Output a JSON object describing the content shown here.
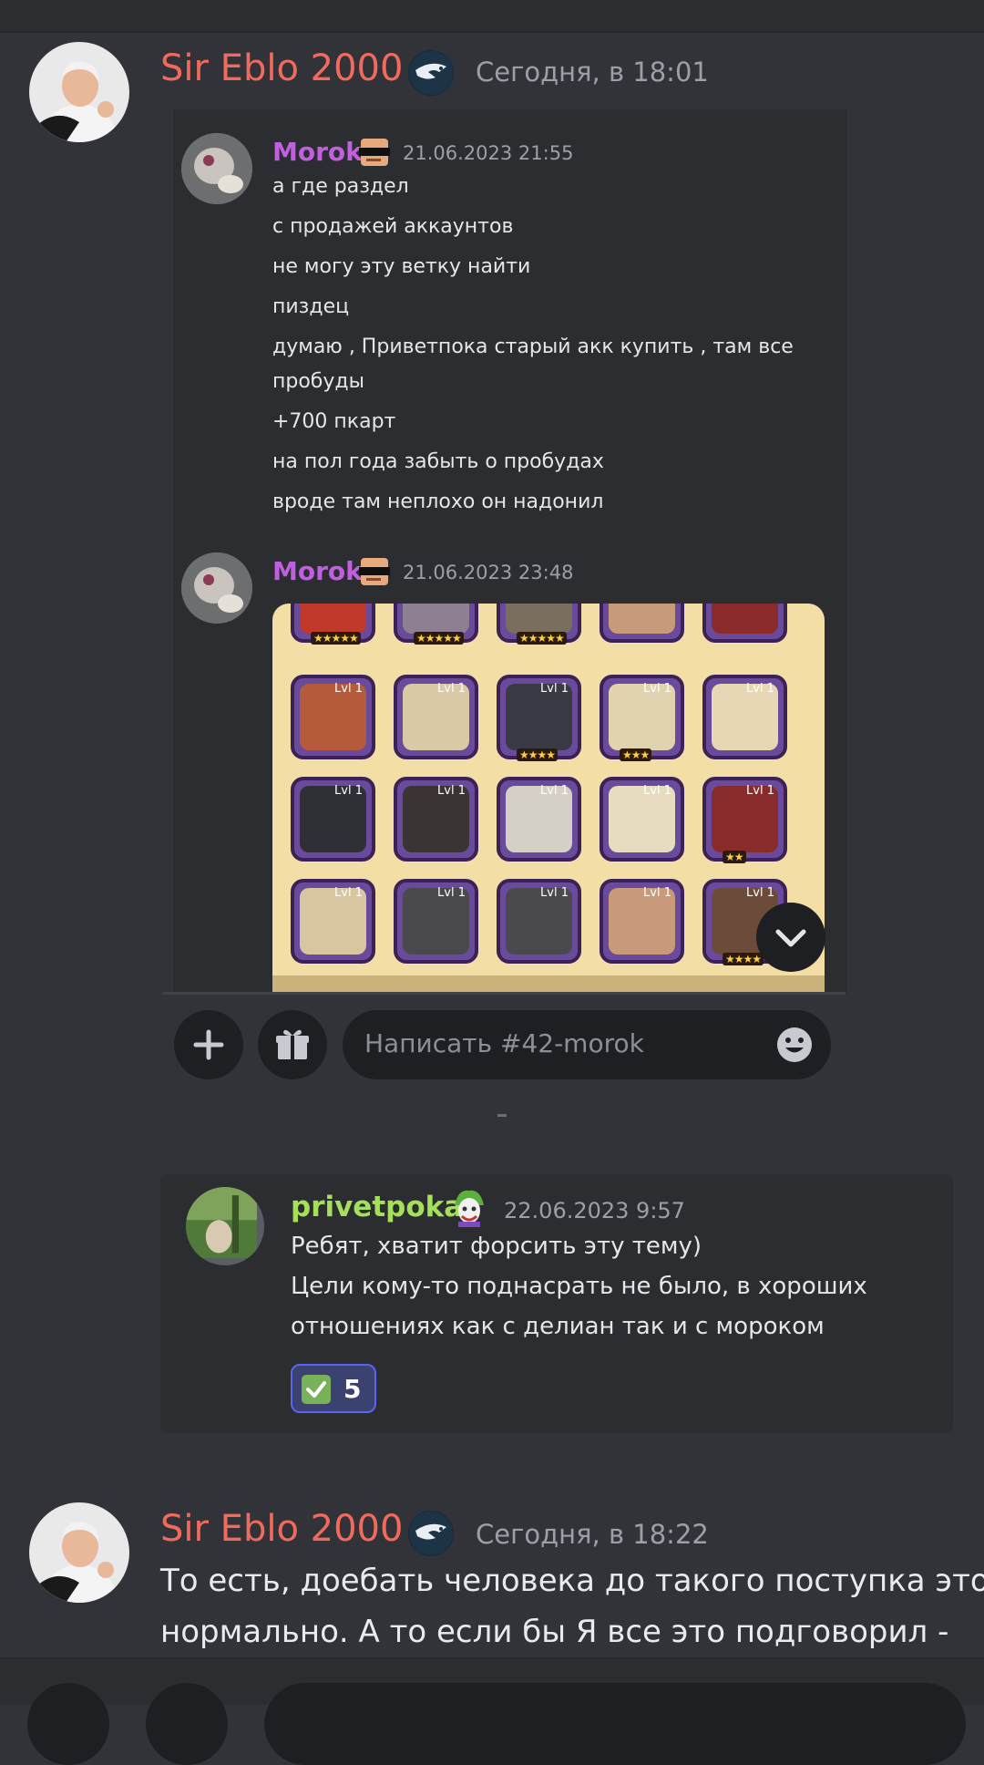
{
  "message1": {
    "author": "Sir Eblo 2000",
    "timestamp": "Сегодня, в 18:01",
    "author_color": "#f26a5d"
  },
  "embed": {
    "msg1": {
      "author": "Morok",
      "timestamp": "21.06.2023 21:55",
      "lines": [
        "а где раздел",
        "с продажей аккаунтов",
        "не могу эту ветку найти",
        "пиздец",
        "думаю , Приветпока старый акк купить , там все",
        "пробуды",
        "+700 пкарт",
        "на пол года забыть о пробудах",
        "вроде там неплохо он надонил"
      ]
    },
    "msg2": {
      "author": "Morok",
      "timestamp": "21.06.2023 23:48"
    },
    "game_levels": [
      "Lvl 1",
      "Lvl 1",
      "Lvl 1",
      "Lvl 1",
      "Lvl 1"
    ],
    "input_placeholder": "Написать #42-morok"
  },
  "quote": {
    "author": "privetpoka",
    "author_color": "#a6e05a",
    "timestamp": "22.06.2023 9:57",
    "lines": [
      "Ребят, хватит форсить эту тему)",
      "Цели кому-то поднасрать не было, в хороших",
      "отношениях как с делиан так и с мороком"
    ],
    "reaction_count": "5"
  },
  "message2": {
    "author": "Sir Eblo 2000",
    "timestamp": "Сегодня, в 18:22",
    "lines": [
      "То есть, доебать человека до такого поступка это",
      "нормально. А то если бы Я все это подговорил -"
    ]
  },
  "icons": [
    "plus-icon",
    "gift-icon",
    "smile-icon",
    "chevron-down-icon",
    "eagle-badge-icon",
    "checkmark-icon",
    "joker-icon",
    "sunglasses-icon"
  ]
}
